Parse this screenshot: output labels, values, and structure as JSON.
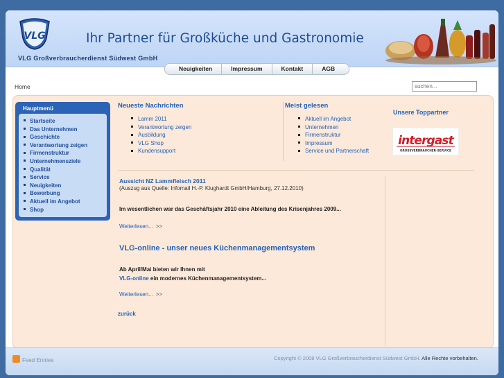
{
  "header": {
    "logo_text": "VLG",
    "company": "VLG Großverbraucherdienst Südwest GmbH",
    "headline": "Ihr Partner für Großküche und Gastronomie"
  },
  "topnav": [
    "Neuigkeiten",
    "Impressum",
    "Kontakt",
    "AGB"
  ],
  "breadcrumb": "Home",
  "search": {
    "placeholder": "suchen..."
  },
  "menu": {
    "title": "Hauptmenü",
    "items": [
      "Startseite",
      "Das Unternehmen",
      "Geschichte",
      "Verantwortung zeigen",
      "Firmenstruktur",
      "Unternehmensziele",
      "Qualität",
      "Service",
      "Neuigkeiten",
      "Bewerbung",
      "Aktuell im Angebot",
      "Shop"
    ]
  },
  "newest": {
    "title": "Neueste Nachrichten",
    "items": [
      "Lamm 2011",
      "Verantwortung zeigen",
      "Ausbildung",
      "VLG Shop",
      "Kundensupport"
    ]
  },
  "most_read": {
    "title": "Meist gelesen",
    "items": [
      "Aktuell im Angebot",
      "Unternehmen",
      "Firmenstruktur",
      "Impressum",
      "Service und Partnerschaft"
    ]
  },
  "articles": [
    {
      "title": "Aussicht NZ Lammfleisch 2011",
      "subtitle": "(Auszug aus Quelle: Infomail H.-P. Klughardt GmbH/Hamburg, 27.12.2010)",
      "teaser": "Im wesentlichen war das Geschäftsjahr 2010 eine Ableitung des Krisenjahres 2009...",
      "more": "Weiterlesen...",
      "arrow": ">>"
    },
    {
      "title": "VLG-online - unser neues Küchenmanagementsystem",
      "teaser_line1": "Ab April/Mai bieten wir Ihnen mit",
      "teaser_link": "VLG-online",
      "teaser_line2": " ein modernes Küchenmanagementsystem...",
      "more": "Weiterlesen...",
      "arrow": ">>"
    }
  ],
  "back": "zurück",
  "partner": {
    "title": "Unsere Toppartner",
    "logo_text": "intergast",
    "logo_sub": "GROSSVERBRAUCHER-SERVICE"
  },
  "footer": {
    "feed": "Feed Entries",
    "copyright": "Copyright © 2008 VLG Großverbraucherdienst Südwest GmbH.",
    "rights": " Alle Rechte vorbehalten."
  },
  "colors": {
    "brand_blue": "#2062bd",
    "page_bg": "#3f6ba3",
    "content_bg": "#fde9d9",
    "partner_red": "#d01f2a"
  }
}
